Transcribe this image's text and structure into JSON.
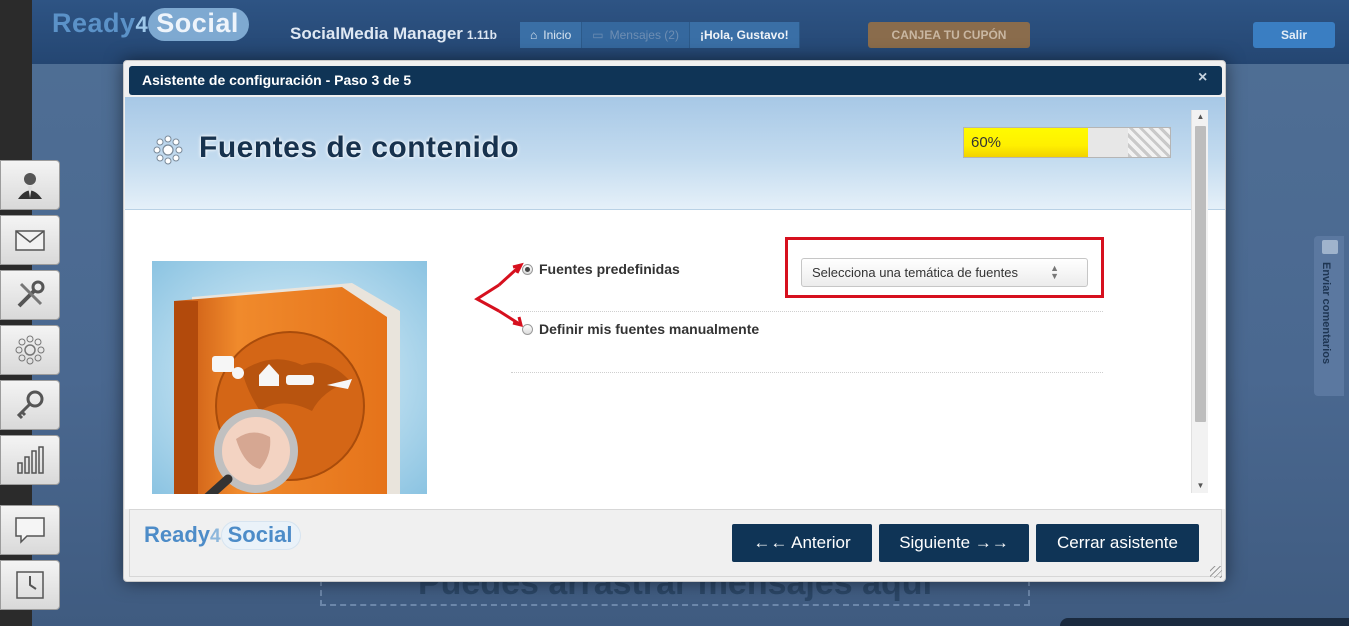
{
  "app": {
    "logo_part1": "Ready",
    "logo_part2": "4",
    "logo_part3": "Social",
    "name": "SocialMedia Manager",
    "version": "1.11b"
  },
  "nav": {
    "inicio": "Inicio",
    "mensajes": "Mensajes (2)",
    "greeting": "¡Hola, Gustavo!",
    "coupon": "CANJEA TU CUPÓN",
    "logout": "Salir"
  },
  "sidebar_tools": [
    "user-icon",
    "mail-icon",
    "tools-icon",
    "sources-icon",
    "key-icon",
    "stats-icon",
    "comment-icon",
    "calendar-icon"
  ],
  "feedback_tab": "Enviar comentarios",
  "background": {
    "drop_text": "Puedes arrastrar mensajes aquí"
  },
  "modal": {
    "title": "Asistente de configuración - Paso 3 de 5",
    "close": "×",
    "heading": "Fuentes de contenido",
    "progress": {
      "value": 60,
      "label": "60%"
    },
    "options": [
      {
        "label": "Fuentes predefinidas",
        "selected": true
      },
      {
        "label": "Definir mis fuentes manualmente",
        "selected": false
      }
    ],
    "theme_select": {
      "selected": "Selecciona una temática de fuentes"
    },
    "footer_logo_part1": "Ready",
    "footer_logo_part2": "4",
    "footer_logo_part3": "Social",
    "buttons": {
      "prev": "←← Anterior",
      "next": "Siguiente →→",
      "close": "Cerrar asistente"
    }
  },
  "colors": {
    "modal_header": "#0f3456",
    "highlight": "#d6101e",
    "progress_fill": "#fff000"
  }
}
